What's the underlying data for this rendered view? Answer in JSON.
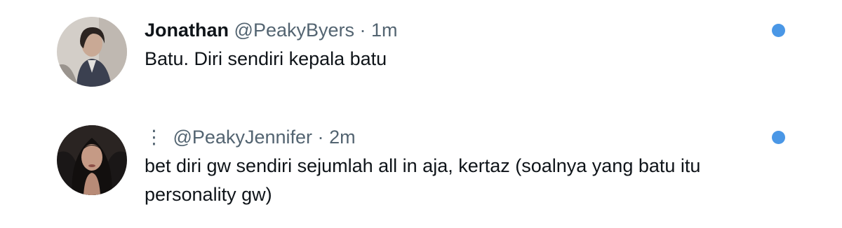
{
  "colors": {
    "text_primary": "#0f1419",
    "text_secondary": "#536471",
    "unread_dot": "#4a97e6"
  },
  "tweets": [
    {
      "avatar_icon": "avatar-man-dark-hair",
      "display_name": "Jonathan",
      "more_glyph": "",
      "handle": "@PeakyByers",
      "separator": "·",
      "time": "1m",
      "text": "Batu. Diri sendiri kepala batu",
      "unread": true
    },
    {
      "avatar_icon": "avatar-woman-dark-hair",
      "display_name": "",
      "more_glyph": "⋮",
      "handle": "@PeakyJennifer",
      "separator": "·",
      "time": "2m",
      "text": "bet diri gw sendiri sejumlah all in aja, kertaz (soalnya yang batu itu personality gw)",
      "unread": true
    }
  ]
}
